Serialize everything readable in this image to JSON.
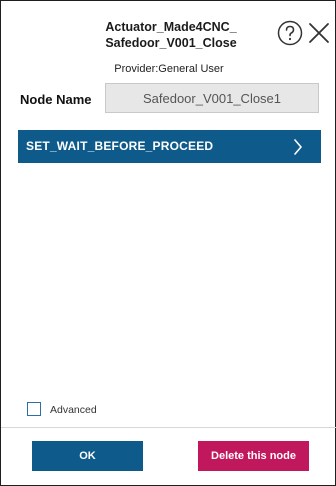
{
  "dialog": {
    "title": "Actuator_Made4CNC_\nSafedoor_V001_Close",
    "help_icon": "question-circle-icon",
    "close_icon": "close-icon",
    "provider": "Provider:General User"
  },
  "node": {
    "label": "Node Name",
    "value": "Safedoor_V001_Close1"
  },
  "actions": [
    {
      "label": "SET_WAIT_BEFORE_PROCEED",
      "icon": "chevron-right-icon"
    }
  ],
  "advanced": {
    "label": "Advanced",
    "checked": false
  },
  "footer": {
    "ok_label": "OK",
    "delete_label": "Delete this node"
  },
  "colors": {
    "primary": "#0e5a8a",
    "danger": "#c1175d",
    "checkbox_border": "#2f6fa6"
  }
}
